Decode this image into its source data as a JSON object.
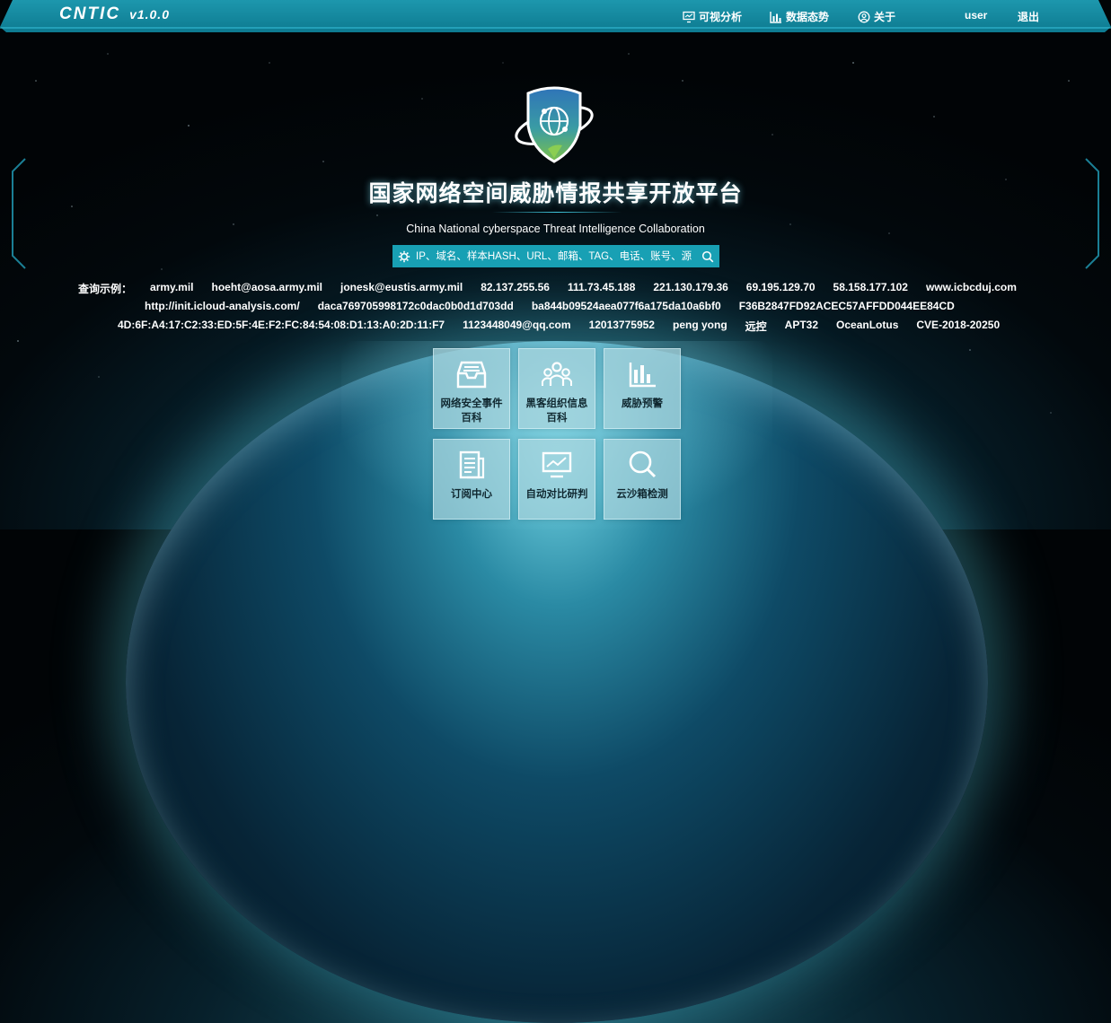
{
  "header": {
    "brand": "CNTIC",
    "version": "v1.0.0",
    "nav": [
      {
        "label": "可视分析",
        "icon": "monitor-chart-icon"
      },
      {
        "label": "数据态势",
        "icon": "bar-chart-icon"
      },
      {
        "label": "关于",
        "icon": "user-circle-icon"
      }
    ],
    "user": "user",
    "logout": "退出"
  },
  "hero": {
    "title": "国家网络空间威胁情报共享开放平台",
    "subtitle": "China National cyberspace Threat Intelligence Collaboration"
  },
  "search": {
    "placeholder": "IP、域名、样本HASH、URL、邮箱、TAG、电话、账号、源",
    "value": ""
  },
  "examples": {
    "label": "查询示例：",
    "row1": [
      "army.mil",
      "hoeht@aosa.army.mil",
      "jonesk@eustis.army.mil",
      "82.137.255.56",
      "111.73.45.188",
      "221.130.179.36",
      "69.195.129.70",
      "58.158.177.102",
      "www.icbcduj.com"
    ],
    "row2": [
      "http://init.icloud-analysis.com/",
      "daca769705998172c0dac0b0d1d703dd",
      "ba844b09524aea077f6a175da10a6bf0",
      "F36B2847FD92ACEC57AFFDD044EE84CD"
    ],
    "row3": [
      "4D:6F:A4:17:C2:33:ED:5F:4E:F2:FC:84:54:08:D1:13:A0:2D:11:F7",
      "1123448049@qq.com",
      "12013775952",
      "peng yong",
      "远控",
      "APT32",
      "OceanLotus",
      "CVE-2018-20250"
    ]
  },
  "tiles": [
    {
      "label": "网络安全事件百科",
      "icon": "inbox-icon"
    },
    {
      "label": "黑客组织信息百科",
      "icon": "group-icon"
    },
    {
      "label": "威胁预警",
      "icon": "bar-chart-icon"
    },
    {
      "label": "订阅中心",
      "icon": "document-icon"
    },
    {
      "label": "自动对比研判",
      "icon": "monitor-chart-icon"
    },
    {
      "label": "云沙箱检测",
      "icon": "search-icon"
    }
  ]
}
